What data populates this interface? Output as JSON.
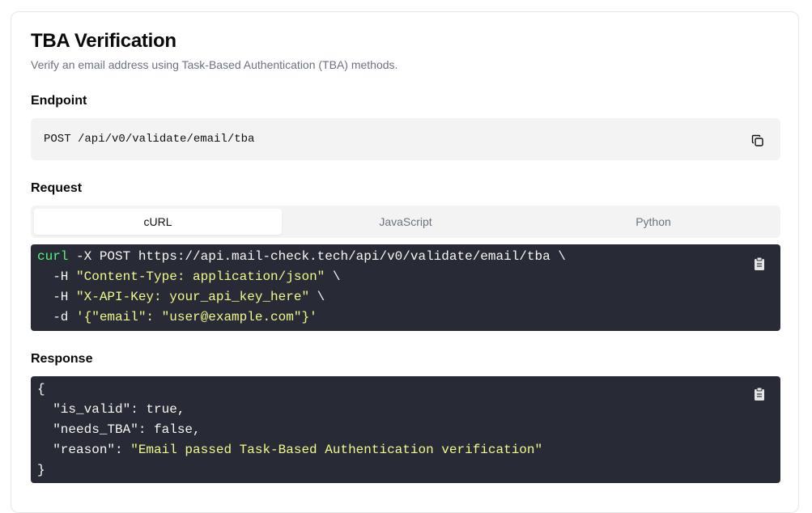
{
  "header": {
    "title": "TBA Verification",
    "subtitle": "Verify an email address using Task-Based Authentication (TBA) methods."
  },
  "endpoint": {
    "label": "Endpoint",
    "value": "POST /api/v0/validate/email/tba",
    "copy_icon": "copy-icon"
  },
  "request": {
    "label": "Request",
    "tabs": [
      {
        "label": "cURL",
        "active": true
      },
      {
        "label": "JavaScript",
        "active": false
      },
      {
        "label": "Python",
        "active": false
      }
    ],
    "code": {
      "line1_cmd": "curl",
      "line1_rest": " -X POST https://api.mail-check.tech/api/v0/validate/email/tba \\",
      "line2_flag": "  -H ",
      "line2_str": "\"Content-Type: application/json\"",
      "line2_tail": " \\",
      "line3_flag": "  -H ",
      "line3_str": "\"X-API-Key: your_api_key_here\"",
      "line3_tail": " \\",
      "line4_flag": "  -d ",
      "line4_str": "'{\"email\": \"user@example.com\"}'"
    },
    "copy_icon": "clipboard-icon"
  },
  "response": {
    "label": "Response",
    "code": {
      "open": "{",
      "line1": "  \"is_valid\": true,",
      "line2": "  \"needs_TBA\": false,",
      "line3_key": "  \"reason\": ",
      "line3_str": "\"Email passed Task-Based Authentication verification\"",
      "close": "}"
    },
    "copy_icon": "clipboard-icon"
  },
  "colors": {
    "code_bg": "#282a36",
    "code_keyword": "#50fa7b",
    "code_string": "#f1fa8c",
    "panel_bg": "#f3f3f3"
  }
}
